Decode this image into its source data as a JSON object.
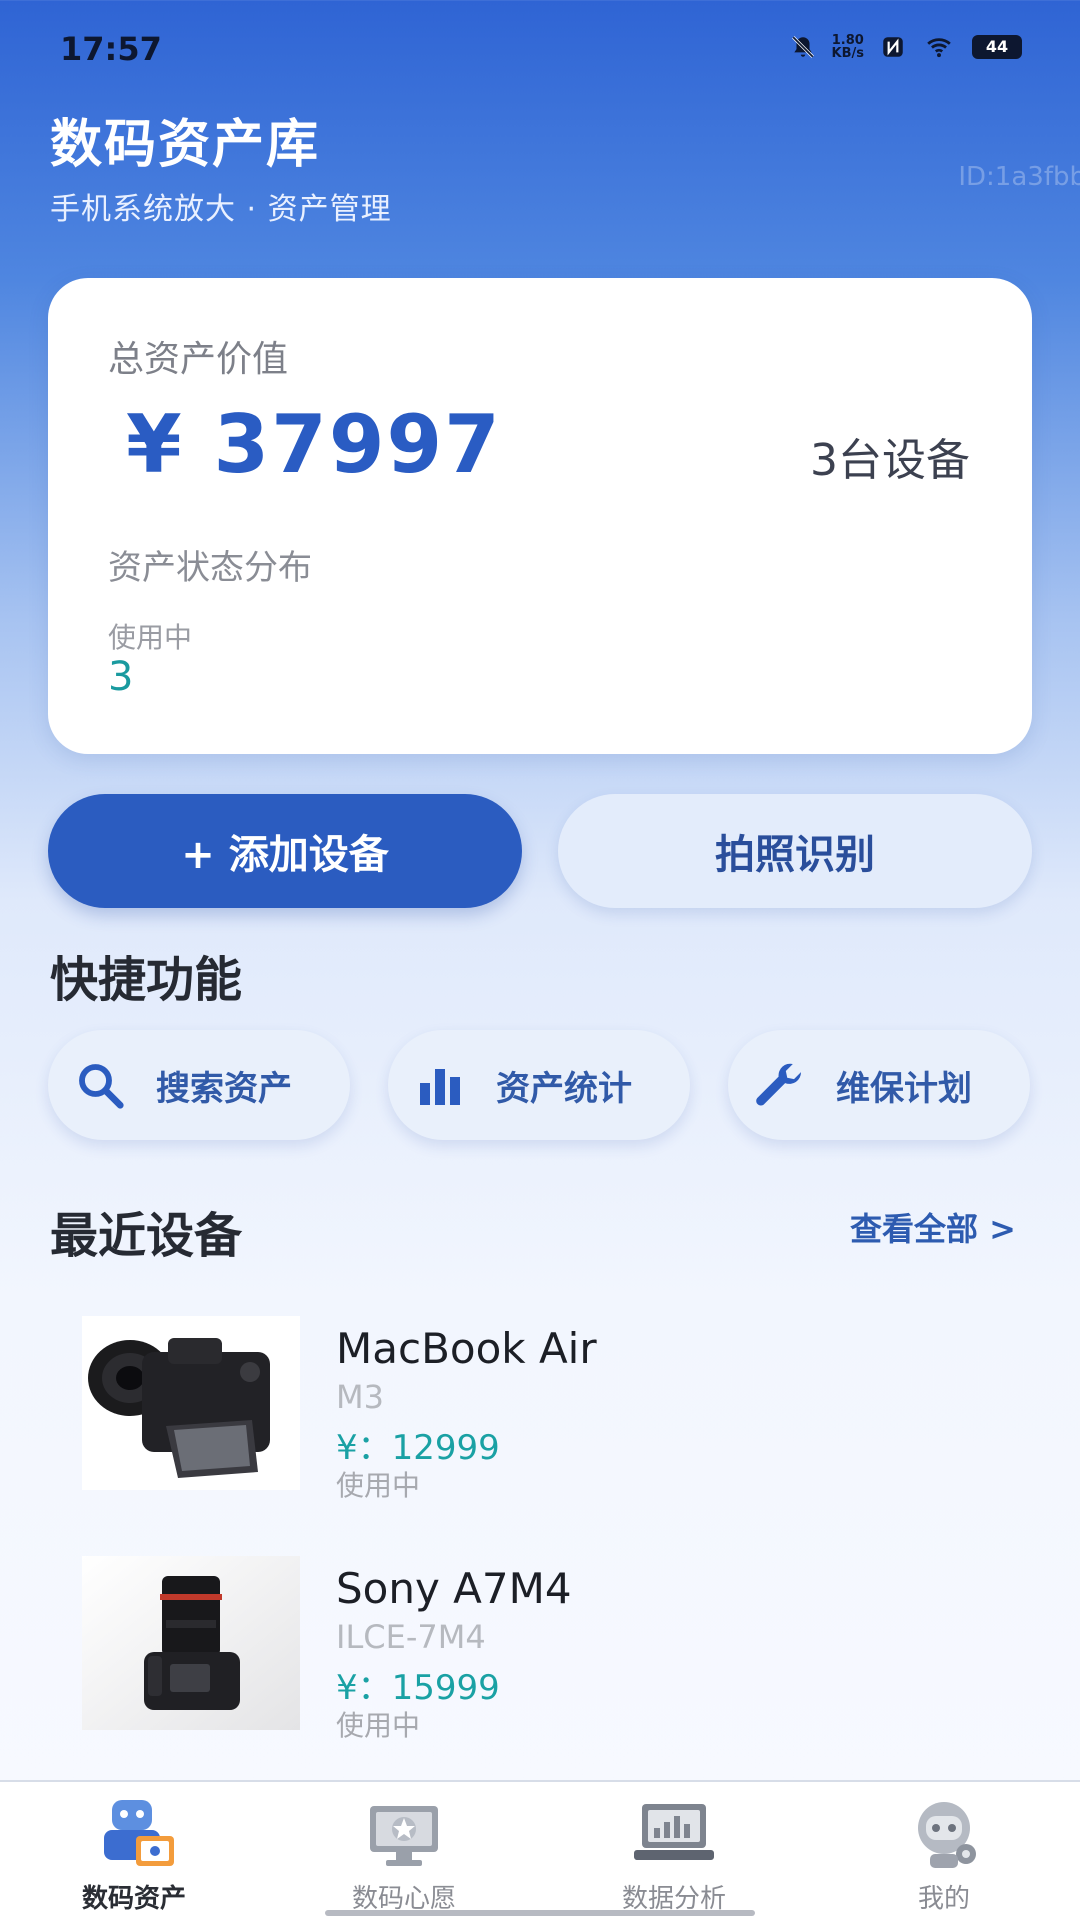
{
  "status_bar": {
    "time": "17:57",
    "net_speed_top": "1.80",
    "net_speed_bottom": "KB/s",
    "battery": "44"
  },
  "header": {
    "title": "数码资产库",
    "subtitle": "手机系统放大 · 资产管理",
    "watermark": "ID:1a3fbb"
  },
  "summary": {
    "total_label": "总资产价值",
    "total_value": "¥ 37997",
    "device_count": "3台设备",
    "distribution_label": "资产状态分布",
    "status_name": "使用中",
    "status_count": "3"
  },
  "actions": {
    "add_label": "+ 添加设备",
    "photo_label": "拍照识别"
  },
  "quick": {
    "title": "快捷功能",
    "items": [
      {
        "label": "搜索资产",
        "icon": "search-icon"
      },
      {
        "label": "资产统计",
        "icon": "bar-chart-icon"
      },
      {
        "label": "维保计划",
        "icon": "wrench-icon"
      }
    ]
  },
  "recent": {
    "title": "最近设备",
    "view_all": "查看全部 >",
    "devices": [
      {
        "name": "MacBook Air",
        "model": "M3",
        "price": "¥：12999",
        "status": "使用中",
        "image": "camera-photo"
      },
      {
        "name": "Sony A7M4",
        "model": "ILCE-7M4",
        "price": "¥：15999",
        "status": "使用中",
        "image": "camera-photo"
      }
    ]
  },
  "nav": {
    "items": [
      {
        "label": "数码资产",
        "icon": "robot-asset-icon",
        "active": true
      },
      {
        "label": "数码心愿",
        "icon": "wish-monitor-icon",
        "active": false
      },
      {
        "label": "数据分析",
        "icon": "laptop-chart-icon",
        "active": false
      },
      {
        "label": "我的",
        "icon": "robot-profile-icon",
        "active": false
      }
    ]
  },
  "colors": {
    "primary": "#2b5cc0",
    "accent_teal": "#1aa1a4",
    "chip_bg": "#e9f0fb"
  }
}
